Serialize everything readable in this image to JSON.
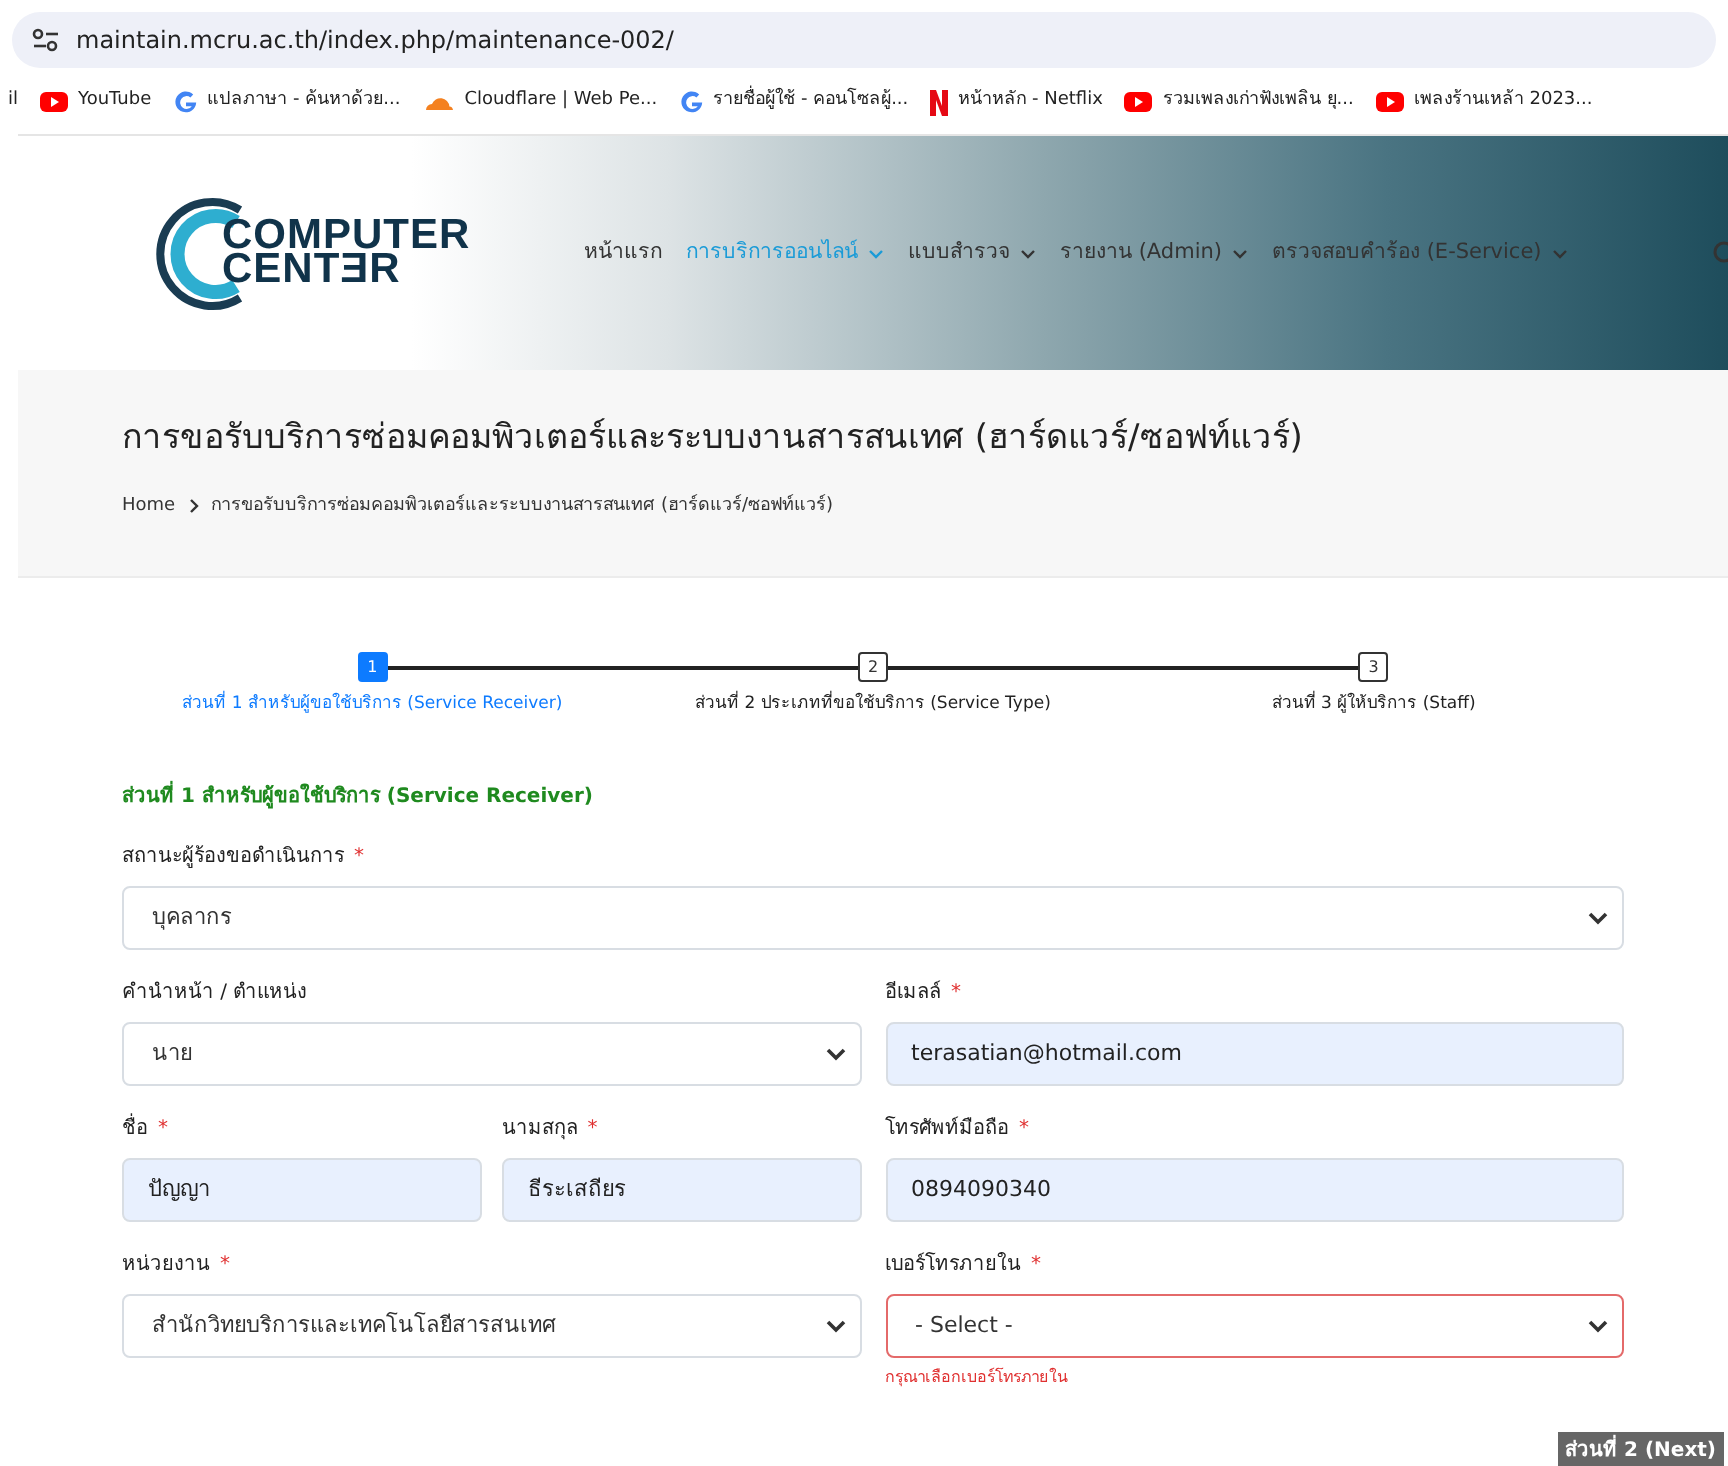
{
  "browser": {
    "url": "maintain.mcru.ac.th/index.php/maintenance-002/",
    "bookmarks": [
      {
        "label": "il",
        "kind": "text"
      },
      {
        "label": "YouTube",
        "kind": "youtube"
      },
      {
        "label": "แปลภาษา - ค้นหาด้วย...",
        "kind": "google"
      },
      {
        "label": "Cloudflare | Web Pe...",
        "kind": "cloudflare"
      },
      {
        "label": "รายชื่อผู้ใช้ - คอนโซลผู้...",
        "kind": "google"
      },
      {
        "label": "หน้าหลัก - Netflix",
        "kind": "netflix"
      },
      {
        "label": "รวมเพลงเก่าฟังเพลิน ยุ...",
        "kind": "youtube"
      },
      {
        "label": "เพลงร้านเหล้า 2023...",
        "kind": "youtube"
      }
    ]
  },
  "header": {
    "logo": {
      "line_1": "COMPUTER",
      "line_2": "CENTƎR"
    },
    "nav": [
      {
        "label": "หน้าแรก",
        "selected": false,
        "dropdown": false
      },
      {
        "label": "การบริการออนไลน์",
        "selected": true,
        "dropdown": true
      },
      {
        "label": "แบบสำรวจ",
        "selected": false,
        "dropdown": true
      },
      {
        "label": "รายงาน (Admin)",
        "selected": false,
        "dropdown": true
      },
      {
        "label": "ตรวจสอบคำร้อง (E-Service)",
        "selected": false,
        "dropdown": true
      }
    ]
  },
  "page_title": "การขอรับบริการซ่อมคอมพิวเตอร์และระบบงานสารสนเทศ (ฮาร์ดแวร์/ซอฟท์แวร์)",
  "breadcrumb": [
    "Home",
    "การขอรับบริการซ่อมคอมพิวเตอร์และระบบงานสารสนเทศ (ฮาร์ดแวร์/ซอฟท์แวร์)"
  ],
  "steps": [
    {
      "number": "1",
      "label": "ส่วนที่ 1 สำหรับผู้ขอใช้บริการ (Service Receiver)",
      "selected": true
    },
    {
      "number": "2",
      "label": "ส่วนที่ 2 ประเภทที่ขอใช้บริการ (Service Type)",
      "selected": false
    },
    {
      "number": "3",
      "label": "ส่วนที่ 3 ผู้ให้บริการ (Staff)",
      "selected": false
    }
  ],
  "form": {
    "section_title": "ส่วนที่ 1 สำหรับผู้ขอใช้บริการ (Service Receiver)",
    "rows": [
      [
        [
          {
            "label": "สถานะผู้ร้องขอดำเนินการ",
            "required_mark": "*",
            "kind": "select",
            "value": "บุคลากร",
            "invalid": false
          }
        ]
      ],
      [
        [
          {
            "label": "คำนำหน้า / ตำแหน่ง",
            "kind": "select",
            "value": "นาย",
            "invalid": false
          }
        ],
        [
          {
            "label": "อีเมลล์",
            "required_mark": "*",
            "kind": "input",
            "value": "terasatian@hotmail.com",
            "invalid": false
          }
        ]
      ],
      [
        [
          {
            "label": "ชื่อ",
            "required_mark": "*",
            "kind": "input",
            "value": "ปัญญา",
            "invalid": false
          },
          {
            "label": "นามสกุล",
            "required_mark": "*",
            "kind": "input",
            "value": "ธีระเสถียร",
            "invalid": false
          }
        ],
        [
          {
            "label": "โทรศัพท์มือถือ",
            "required_mark": "*",
            "kind": "input",
            "value": "0894090340",
            "invalid": false
          }
        ]
      ],
      [
        [
          {
            "label": "หน่วยงาน",
            "required_mark": "*",
            "kind": "select",
            "value": "สำนักวิทยบริการและเทคโนโลยีสารสนเทศ",
            "invalid": false
          }
        ],
        [
          {
            "label": "เบอร์โทรภายใน",
            "required_mark": "*",
            "kind": "select",
            "value": "- Select -",
            "invalid": true,
            "error": "กรุณาเลือกเบอร์โทรภายใน"
          }
        ]
      ]
    ],
    "next_button": "ส่วนที่ 2 (Next)"
  }
}
